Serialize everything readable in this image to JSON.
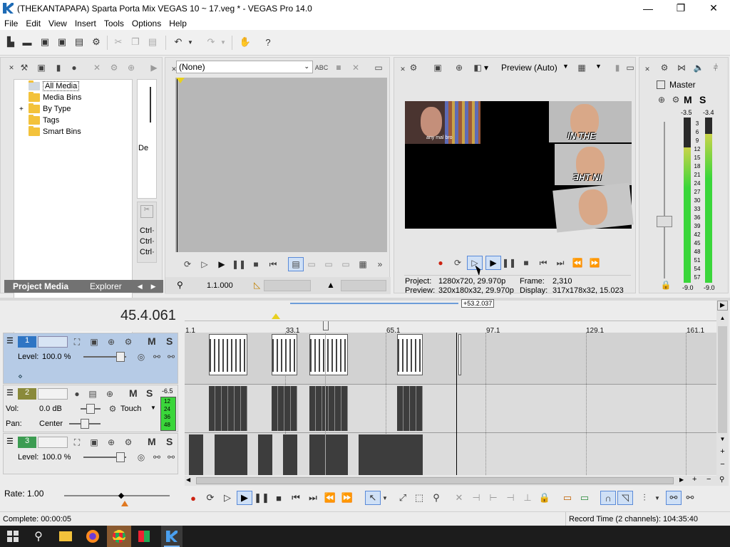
{
  "window": {
    "title": "(THEKANTAPAPA) Sparta Porta Mix VEGAS 10 ~ 17.veg * - VEGAS Pro 14.0",
    "min": "—",
    "max": "❐",
    "close": "✕"
  },
  "menu": [
    "File",
    "Edit",
    "View",
    "Insert",
    "Tools",
    "Options",
    "Help"
  ],
  "media": {
    "tree": [
      {
        "label": "All Media",
        "expander": ""
      },
      {
        "label": "Media Bins",
        "expander": ""
      },
      {
        "label": "By Type",
        "expander": "+"
      },
      {
        "label": "Tags",
        "expander": ""
      },
      {
        "label": "Smart Bins",
        "expander": ""
      }
    ],
    "tab_project": "Project Media",
    "tab_explorer": "Explorer",
    "side_label": "De",
    "ctrl_lines": [
      "Ctrl·",
      "Ctrl·",
      "Ctrl·"
    ]
  },
  "trimmer": {
    "dropdown": "(None)",
    "position": "1.1.000"
  },
  "preview": {
    "mode": "Preview (Auto)",
    "project_label": "Project:",
    "project_value": "1280x720, 29.970p",
    "preview_label": "Preview:",
    "preview_value": "320x180x32, 29.970p",
    "frame_label": "Frame:",
    "frame_value": "2,310",
    "display_label": "Display:",
    "display_value": "317x178x32, 15.023",
    "cap1": "any mal bro",
    "cap2": "IN THE",
    "cap3": "ƎHT NI"
  },
  "master": {
    "title": "Master",
    "m": "M",
    "s": "S",
    "peak_l": "-3.5",
    "peak_r": "-3.4",
    "scale": [
      "3",
      "6",
      "9",
      "12",
      "15",
      "18",
      "21",
      "24",
      "27",
      "30",
      "33",
      "36",
      "39",
      "42",
      "45",
      "48",
      "51",
      "54",
      "57"
    ],
    "bottom_l": "-9.0",
    "bottom_r": "-9.0",
    "level_left": 0.82,
    "level_right": 0.9
  },
  "timeline": {
    "time": "45.4.061",
    "region_label": "+53.2.037",
    "ticks": [
      "1.1",
      "33.1",
      "65.1",
      "97.1",
      "129.1",
      "161.1"
    ]
  },
  "tracks": [
    {
      "num": "1",
      "level_label": "Level:",
      "level_value": "100.0 %",
      "m": "M",
      "s": "S"
    },
    {
      "num": "2",
      "vol_label": "Vol:",
      "vol_value": "0.0 dB",
      "pan_label": "Pan:",
      "pan_value": "Center",
      "touch": "Touch",
      "m": "M",
      "s": "S",
      "peak": "-6.5",
      "meter": [
        "12",
        "24",
        "36",
        "48"
      ]
    },
    {
      "num": "3",
      "level_label": "Level:",
      "level_value": "100.0 %",
      "m": "M",
      "s": "S"
    }
  ],
  "rate": {
    "label": "Rate: 1.00"
  },
  "status": {
    "left": "Complete: 00:00:05",
    "right": "Record Time (2 channels): 104:35:40"
  },
  "colors": {
    "track1": "#b6cbe6",
    "track2": "#8a8a3a",
    "track3": "#3c9c52",
    "meter": "#3ad63a"
  }
}
